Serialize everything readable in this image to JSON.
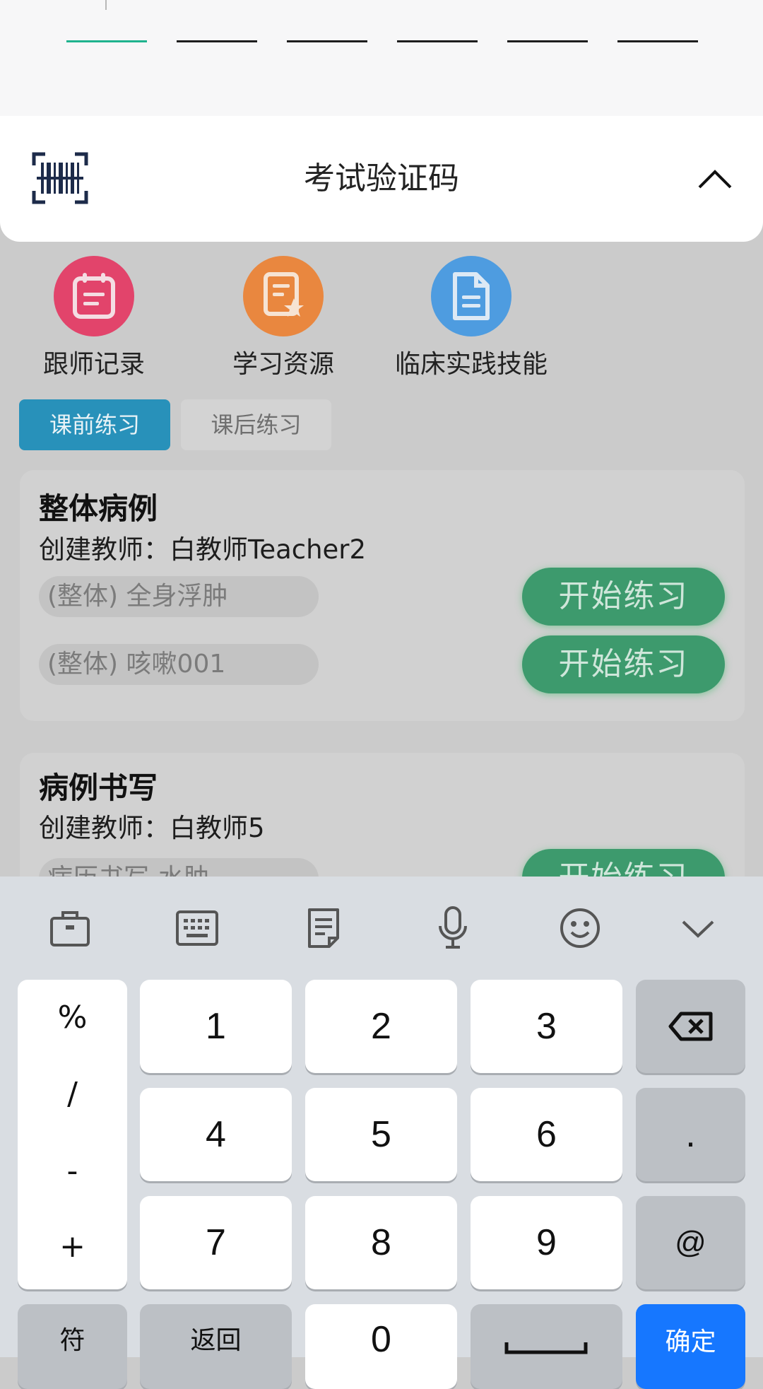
{
  "verification": {
    "title": "考试验证码",
    "slots": 6,
    "icons": {
      "barcode": "barcode-icon",
      "collapse": "chevron-up-icon"
    }
  },
  "features": [
    {
      "label": "跟师记录",
      "icon": "calendar-note-icon",
      "color": "#e2446b"
    },
    {
      "label": "学习资源",
      "icon": "document-star-icon",
      "color": "#e9873f"
    },
    {
      "label": "临床实践技能",
      "icon": "document-icon",
      "color": "#4e9ce0"
    }
  ],
  "tabs": [
    {
      "label": "课前练习",
      "active": true
    },
    {
      "label": "课后练习",
      "active": false
    }
  ],
  "cards": [
    {
      "title": "整体病例",
      "teacher": "创建教师：白教师Teacher2",
      "cases": [
        {
          "name": "(整体) 全身浮肿",
          "button": "开始练习"
        },
        {
          "name": "(整体) 咳嗽001",
          "button": "开始练习"
        }
      ]
    },
    {
      "title": "病例书写",
      "teacher": "创建教师：白教师5",
      "cases": [
        {
          "name": "病历书写-水肿",
          "button": "开始练习"
        }
      ]
    }
  ],
  "keyboard": {
    "toolbar": [
      "toolbox-icon",
      "keyboard-icon",
      "clipboard-icon",
      "microphone-icon",
      "emoji-icon",
      "chevron-down-icon"
    ],
    "symbols": [
      "%",
      "/",
      "-",
      "+"
    ],
    "digits": [
      "1",
      "2",
      "3",
      "4",
      "5",
      "6",
      "7",
      "8",
      "9"
    ],
    "backspace_icon": "backspace-icon",
    "dot": ".",
    "at": "@",
    "sym_key": "符",
    "back_key": "返回",
    "zero": "0",
    "space_icon": "space-icon",
    "confirm": "确定"
  }
}
